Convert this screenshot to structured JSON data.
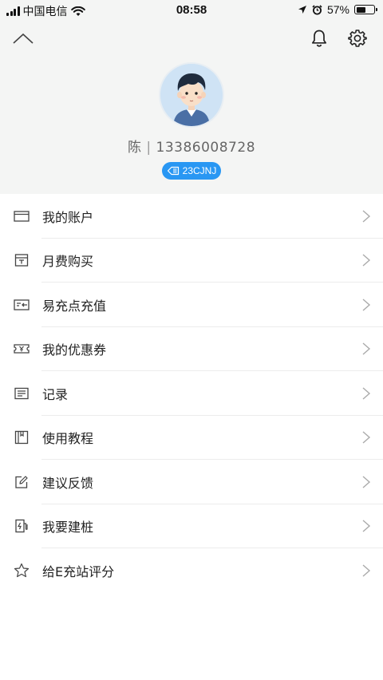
{
  "status_bar": {
    "carrier": "中国电信",
    "time": "08:58",
    "battery": "57%",
    "battery_level": 0.57
  },
  "header": {
    "user_name": "陈",
    "separator": "|",
    "phone": "13386008728",
    "badge_code": "23CJNJ",
    "icons": [
      "chevron-up-icon",
      "bell-icon",
      "gear-icon"
    ]
  },
  "menu": {
    "items": [
      {
        "label": "我的账户",
        "icon": "wallet-icon"
      },
      {
        "label": "月费购买",
        "icon": "calendar-icon"
      },
      {
        "label": "易充点充值",
        "icon": "card-recharge-icon"
      },
      {
        "label": "我的优惠券",
        "icon": "coupon-icon"
      },
      {
        "label": "记录",
        "icon": "document-icon"
      },
      {
        "label": "使用教程",
        "icon": "book-icon"
      },
      {
        "label": "建议反馈",
        "icon": "edit-icon"
      },
      {
        "label": "我要建桩",
        "icon": "charging-pile-icon"
      },
      {
        "label": "给E充站评分",
        "icon": "star-icon"
      }
    ]
  },
  "colors": {
    "header_bg": "#f4f5f4",
    "badge_bg": "#2997f3",
    "divider": "#ececec"
  }
}
